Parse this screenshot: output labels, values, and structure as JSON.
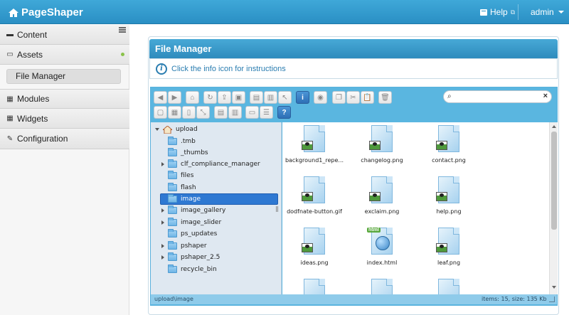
{
  "topbar": {
    "logo": "PageShaper",
    "help_label": "Help",
    "user_label": "admin"
  },
  "sidebar": {
    "items": [
      {
        "label": "Content"
      },
      {
        "label": "Assets"
      },
      {
        "label": "Modules"
      },
      {
        "label": "Widgets"
      },
      {
        "label": "Configuration"
      }
    ],
    "subitem": "File Manager"
  },
  "main": {
    "title": "File Manager",
    "info_text": "Click the info icon for instructions"
  },
  "file_manager": {
    "tree": [
      {
        "label": "upload"
      },
      {
        "label": ".tmb"
      },
      {
        "label": "_thumbs"
      },
      {
        "label": "clf_compliance_manager"
      },
      {
        "label": "files"
      },
      {
        "label": "flash"
      },
      {
        "label": "image"
      },
      {
        "label": "image_gallery"
      },
      {
        "label": "image_slider"
      },
      {
        "label": "ps_updates"
      },
      {
        "label": "pshaper"
      },
      {
        "label": "pshaper_2.5"
      },
      {
        "label": "recycle_bin"
      }
    ],
    "files": [
      {
        "name": "background1_repe..."
      },
      {
        "name": "changelog.png"
      },
      {
        "name": "contact.png"
      },
      {
        "name": "dodfnate-button.gif"
      },
      {
        "name": "exclaim.png"
      },
      {
        "name": "help.png"
      },
      {
        "name": "ideas.png"
      },
      {
        "name": "index.html"
      },
      {
        "name": "leaf.png"
      }
    ],
    "html_badge": "html",
    "status_path": "upload\\image",
    "status_info": "items: 15, size: 135 Kb"
  },
  "colors": {
    "topbar": "#2a8fc4",
    "panel_header": "#2e8bbd",
    "selection": "#2e78d2"
  }
}
